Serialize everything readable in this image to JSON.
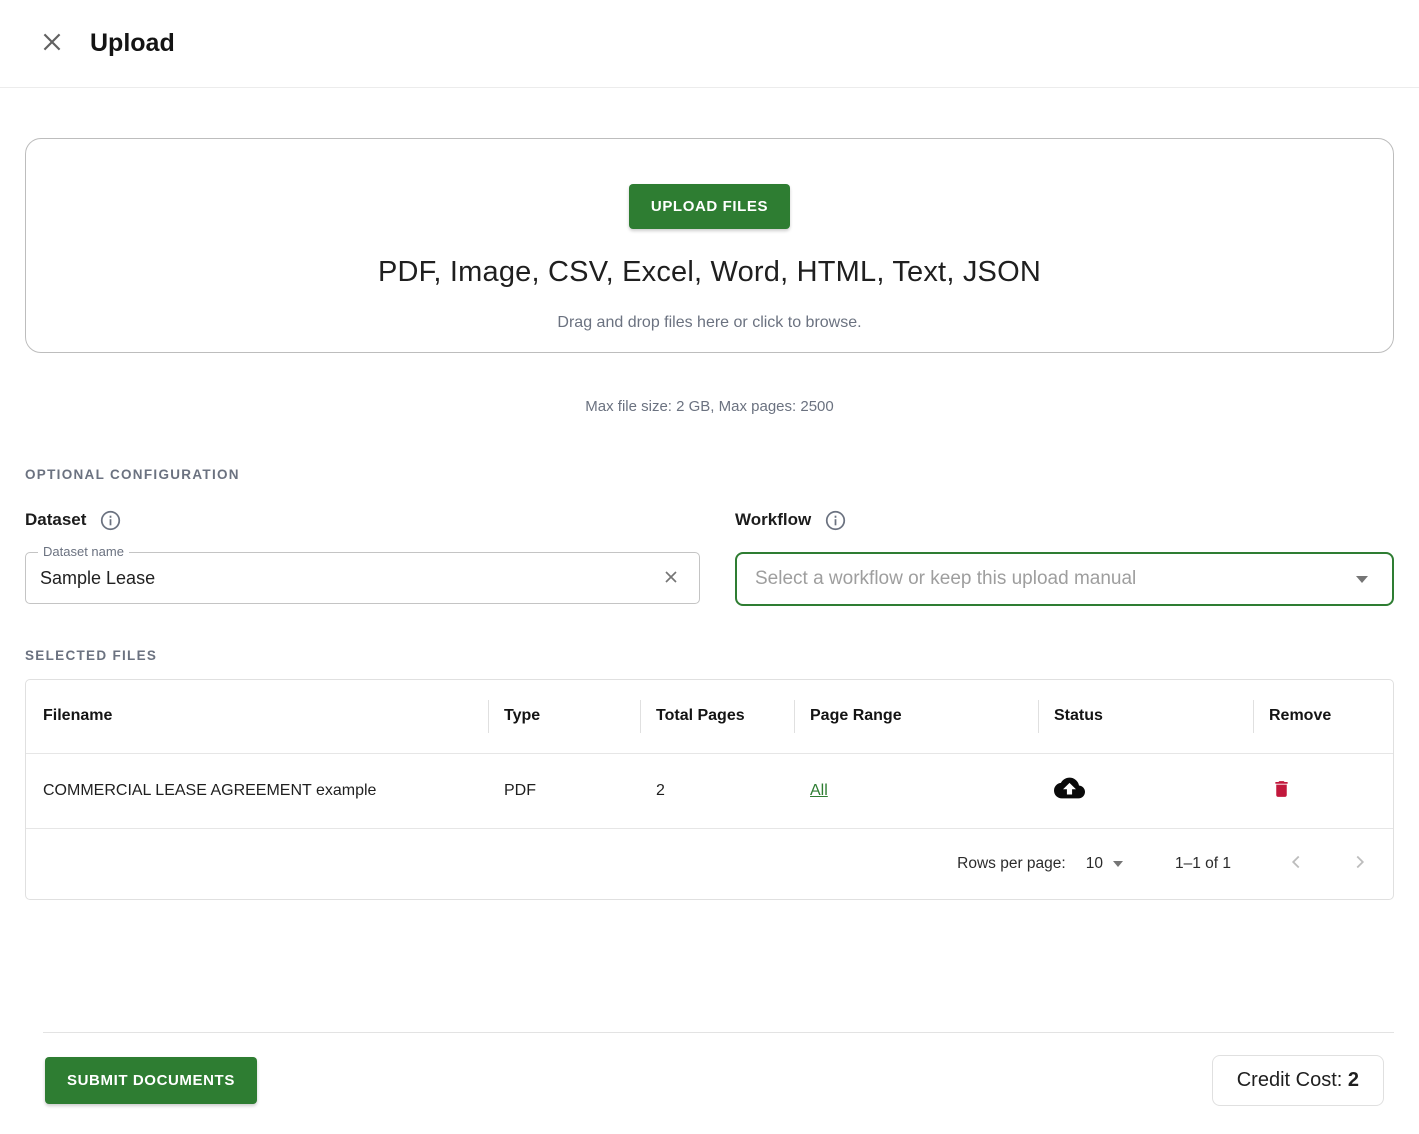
{
  "header": {
    "title": "Upload"
  },
  "dropzone": {
    "upload_button_label": "UPLOAD FILES",
    "formats": "PDF, Image, CSV, Excel, Word, HTML, Text, JSON",
    "hint": "Drag and drop files here or click to browse.",
    "limits": "Max file size: 2 GB, Max pages: 2500"
  },
  "optional_config": {
    "section_title": "OPTIONAL CONFIGURATION",
    "dataset": {
      "label": "Dataset",
      "field_label": "Dataset name",
      "value": "Sample Lease"
    },
    "workflow": {
      "label": "Workflow",
      "placeholder": "Select a workflow or keep this upload manual"
    }
  },
  "selected_files": {
    "section_title": "SELECTED FILES",
    "columns": [
      "Filename",
      "Type",
      "Total Pages",
      "Page Range",
      "Status",
      "Remove"
    ],
    "rows": [
      {
        "filename": "COMMERCIAL LEASE AGREEMENT example",
        "type": "PDF",
        "total_pages": "2",
        "page_range": "All"
      }
    ],
    "pagination": {
      "rows_per_page_label": "Rows per page:",
      "rows_per_page_value": "10",
      "range": "1–1 of 1"
    }
  },
  "footer": {
    "submit_button_label": "SUBMIT DOCUMENTS",
    "credit_cost_label": "Credit Cost: ",
    "credit_cost_value": "2"
  },
  "colors": {
    "accent_green": "#2e7d32",
    "danger_red": "#c2183c",
    "muted_text": "#6b7280"
  }
}
